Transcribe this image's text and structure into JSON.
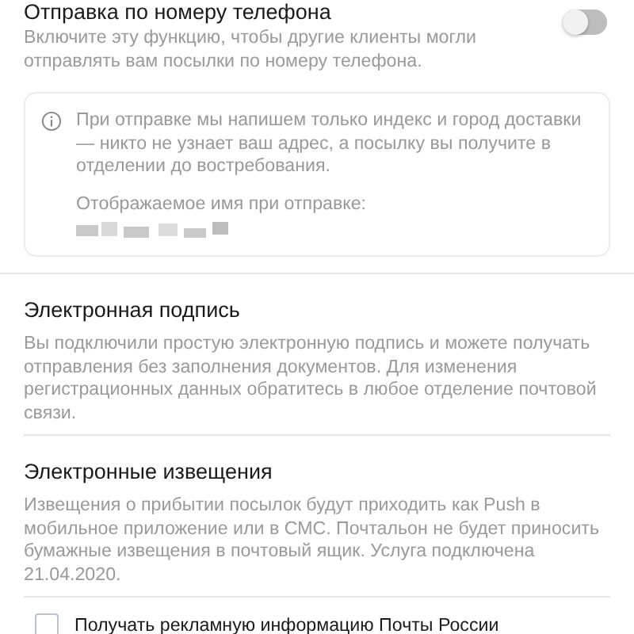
{
  "phone_sending": {
    "title": "Отправка по номеру телефона",
    "description": "Включите эту функцию, чтобы другие клиенты могли отправлять вам посылки по номеру телефона.",
    "on": false,
    "info": {
      "text": "При отправке мы напишем только индекс и город доставки — никто не узнает ваш адрес, а посылку вы получите в отделении до востребования.",
      "name_label": "Отображаемое имя при отправке:"
    }
  },
  "sections": [
    {
      "title": "Электронная подпись",
      "text": "Вы подключили простую электронную подпись и можете получать отправления без заполнения документов. Для изменения регистрационных данных обратитесь в любое отделение почтовой связи."
    },
    {
      "title": "Электронные извещения",
      "text": "Извещения о прибытии посылок будут приходить как Push в мобильное приложение или в СМС. Почтальон не будет приносить бумажные извещения в почтовый ящик. Услуга подключена 21.04.2020."
    }
  ],
  "ads_checkbox": {
    "label": "Получать рекламную информацию Почты России",
    "checked": false
  }
}
